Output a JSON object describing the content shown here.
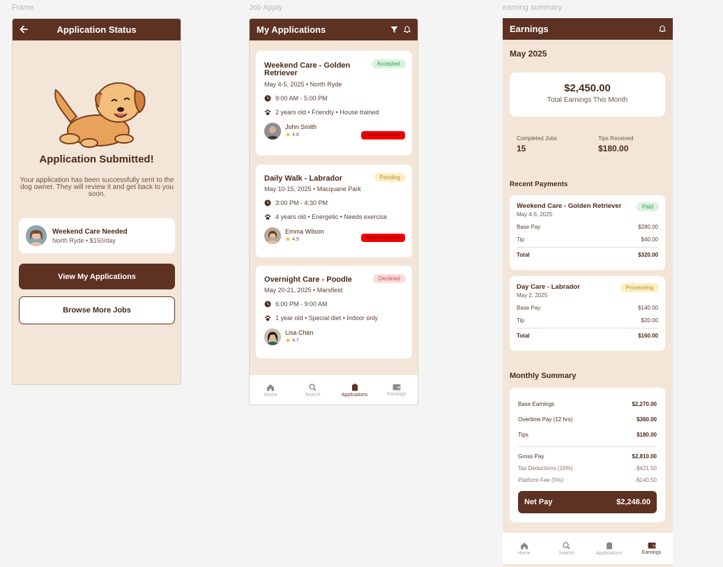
{
  "labels": {
    "frame1": "Frame",
    "frame2": "Job Apply",
    "frame3": "earning summary"
  },
  "status_screen": {
    "title": "Application Status",
    "heading": "Application Submitted!",
    "message": "Your application has been successfully sent to the dog owner. They will review it and get back to you soon.",
    "job_title": "Weekend Care Needed",
    "job_sub": "North Ryde • $150/day",
    "primary_button": "View My Applications",
    "secondary_button": "Browse More Jobs"
  },
  "applications_screen": {
    "title": "My Applications",
    "cards": [
      {
        "title": "Weekend Care - Golden Retriever",
        "status": "Accepted",
        "date": "May 4-5, 2025 • North Ryde",
        "time": "9:00 AM - 5:00 PM",
        "pet": "2 years old • Friendly • House trained",
        "owner": "John Smith",
        "rating": "4.8",
        "action": "Withdraw Application"
      },
      {
        "title": "Daily Walk - Labrador",
        "status": "Pending",
        "date": "May 10-15, 2025 • Macquarie Park",
        "time": "3:00 PM - 4:30 PM",
        "pet": "4 years old • Energetic • Needs exercise",
        "owner": "Emma Wilson",
        "rating": "4.9",
        "action": "Withdraw Application"
      },
      {
        "title": "Overnight Care - Poodle",
        "status": "Declined",
        "date": "May 20-21, 2025 • Marsfield",
        "time": "6:00 PM - 9:00 AM",
        "pet": "1 year old • Special diet • Indoor only",
        "owner": "Lisa Chen",
        "rating": "4.7"
      }
    ]
  },
  "nav": {
    "home": "Home",
    "search": "Search",
    "applications": "Applications",
    "earnings": "Earnings"
  },
  "earnings_screen": {
    "title": "Earnings",
    "month": "May 2025",
    "total_amount": "$2,450.00",
    "total_label": "Total Earnings This Month",
    "completed_label": "Completed Jobs",
    "completed_value": "15",
    "tips_label": "Tips Received",
    "tips_value": "$180.00",
    "recent_title": "Recent Payments",
    "payments": [
      {
        "title": "Weekend Care - Golden Retriever",
        "status": "Paid",
        "date": "May 4-5, 2025",
        "base_label": "Base Pay",
        "base": "$280.00",
        "tip_label": "Tip",
        "tip": "$40.00",
        "total_label": "Total",
        "total": "$320.00"
      },
      {
        "title": "Day Care - Labrador",
        "status": "Processing",
        "date": "May 2, 2025",
        "base_label": "Base Pay",
        "base": "$140.00",
        "tip_label": "Tip",
        "tip": "$20.00",
        "total_label": "Total",
        "total": "$160.00"
      }
    ],
    "summary_title": "Monthly Summary",
    "summary": {
      "base_label": "Base Earnings",
      "base": "$2,270.00",
      "overtime_label": "Overtime Pay (12 hrs)",
      "overtime": "$360.00",
      "tips_label": "Tips",
      "tips": "$180.00",
      "gross_label": "Gross Pay",
      "gross": "$2,810.00",
      "tax_label": "Tax Deductions (15%)",
      "tax": "-$421.50",
      "fee_label": "Platform Fee (5%)",
      "fee": "-$140.50",
      "net_label": "Net Pay",
      "net": "$2,248.00"
    }
  },
  "colors": {
    "brand": "#5d3223",
    "background": "#f3e6d8",
    "withdraw": "#f20000"
  }
}
